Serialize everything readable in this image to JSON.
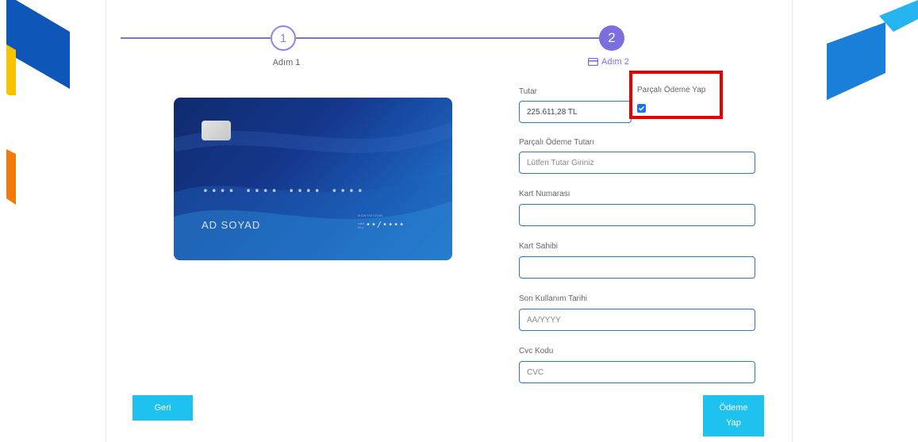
{
  "stepper": {
    "step1": {
      "number": "1",
      "label": "Adım 1"
    },
    "step2": {
      "number": "2",
      "label": "Adım 2",
      "icon": "credit-card-icon"
    }
  },
  "card_preview": {
    "number_mask": "•••• •••• •••• ••••",
    "holder": "AD SOYAD",
    "valid_thru_small": "MONTH/YEAR",
    "valid_label_line1": "valid",
    "valid_label_line2": "thru",
    "expiry_mask": "••/••••"
  },
  "form": {
    "amount": {
      "label": "Tutar",
      "value": "225.611,28 TL"
    },
    "partial_payment": {
      "label": "Parçalı Ödeme Yap",
      "checked": true
    },
    "partial_amount": {
      "label": "Parçalı Ödeme Tutarı",
      "placeholder": "Lütfen Tutar Giriniz"
    },
    "card_number": {
      "label": "Kart Numarası",
      "placeholder": ""
    },
    "card_holder": {
      "label": "Kart Sahibi",
      "placeholder": ""
    },
    "expiry": {
      "label": "Son Kullanım Tarihi",
      "placeholder": "AA/YYYY"
    },
    "cvc": {
      "label": "Cvc Kodu",
      "placeholder": "CVC"
    }
  },
  "buttons": {
    "back": "Geri",
    "pay": "Ödeme Yap"
  },
  "colors": {
    "accent": "#7b6fe0",
    "button": "#1ec2ee",
    "input_border": "#2f74d0",
    "highlight": "#e60000"
  }
}
